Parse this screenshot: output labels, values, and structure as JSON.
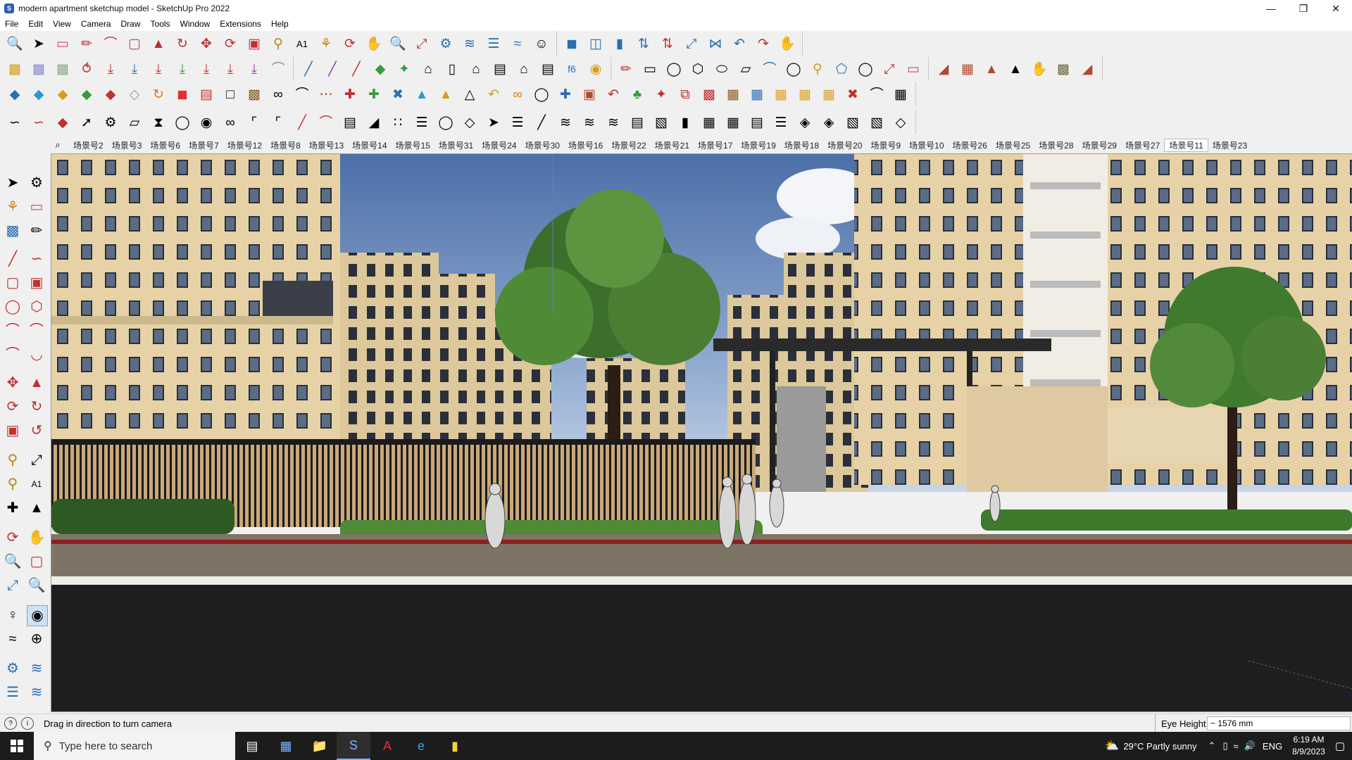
{
  "window": {
    "title": "modern apartment sketchup model - SketchUp Pro 2022",
    "controls": [
      "minimize-icon",
      "restore-icon",
      "close-icon"
    ]
  },
  "menu": [
    "File",
    "Edit",
    "View",
    "Camera",
    "Draw",
    "Tools",
    "Window",
    "Extensions",
    "Help"
  ],
  "scenes": {
    "tabs": [
      "场景号2",
      "场景号3",
      "场景号6",
      "场景号7",
      "场景号12",
      "场景号8",
      "场景号13",
      "场景号14",
      "场景号15",
      "场景号31",
      "场景号24",
      "场景号30",
      "场景号16",
      "场景号22",
      "场景号21",
      "场景号17",
      "场景号19",
      "场景号18",
      "场景号20",
      "场景号9",
      "场景号10",
      "场景号26",
      "场景号25",
      "场景号28",
      "场景号29",
      "场景号27",
      "场景号11",
      "场景号23"
    ],
    "active": "场景号11"
  },
  "status": {
    "hint": "Drag in direction to turn camera",
    "measure_label": "Eye Height",
    "measure_value": "~ 1576 mm"
  },
  "taskbar": {
    "search_placeholder": "Type here to search",
    "weather": "29°C  Partly sunny",
    "language": "ENG",
    "time": "6:19 AM",
    "date": "8/9/2023"
  },
  "colors": {
    "sky": "#5b7fb8",
    "building": "#e6d2a6",
    "road": "#1e1e20",
    "taskbar": "#1c1c1c"
  }
}
